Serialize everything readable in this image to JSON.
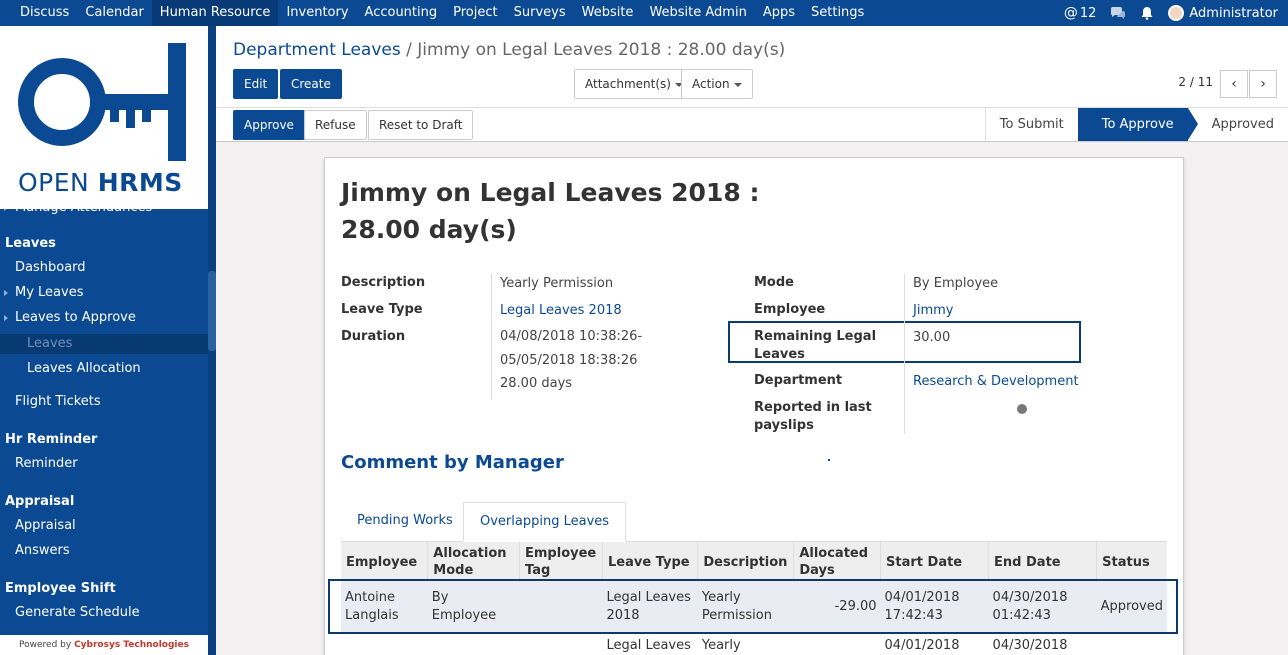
{
  "topbar": {
    "menu": [
      "Discuss",
      "Calendar",
      "Human Resource",
      "Inventory",
      "Accounting",
      "Project",
      "Surveys",
      "Website",
      "Website Admin",
      "Apps",
      "Settings"
    ],
    "active_menu": "Human Resource",
    "mentions_count": "12",
    "user": "Administrator"
  },
  "logo": {
    "word1": "OPEN ",
    "word2": "HRMS"
  },
  "sidebar": {
    "partial_item": "Manage Attendances",
    "leaves_header": "Leaves",
    "dashboard": "Dashboard",
    "my_leaves": "My Leaves",
    "leaves_to_approve": "Leaves to Approve",
    "leaves": "Leaves",
    "leaves_allocation": "Leaves Allocation",
    "flight_tickets": "Flight Tickets",
    "hr_reminder_header": "Hr Reminder",
    "reminder": "Reminder",
    "appraisal_header": "Appraisal",
    "appraisal": "Appraisal",
    "answers": "Answers",
    "employee_shift_header": "Employee Shift",
    "generate_schedule": "Generate Schedule",
    "powered_prefix": "Powered by ",
    "powered_company": "Cybrosys Technologies"
  },
  "breadcrumb": {
    "parent": "Department Leaves",
    "separator": " / ",
    "current": "Jimmy on Legal Leaves 2018 : 28.00 day(s)"
  },
  "toolbar": {
    "edit": "Edit",
    "create": "Create",
    "attachments": "Attachment(s)",
    "action": "Action",
    "pager": "2 / 11",
    "prev": "‹",
    "next": "›"
  },
  "statusbar": {
    "approve": "Approve",
    "refuse": "Refuse",
    "reset": "Reset to Draft",
    "stages": [
      "To Submit",
      "To Approve",
      "Approved"
    ],
    "current_stage": "To Approve"
  },
  "form": {
    "title_line1": "Jimmy on Legal Leaves 2018 :",
    "title_line2": "28.00 day(s)",
    "description_label": "Description",
    "description": "Yearly Permission",
    "leave_type_label": "Leave Type",
    "leave_type": "Legal Leaves 2018",
    "duration_label": "Duration",
    "duration_from": "04/08/2018 10:38:26-",
    "duration_to": "05/05/2018 18:38:26",
    "duration_days": "28.00 days",
    "mode_label": "Mode",
    "mode": "By Employee",
    "employee_label": "Employee",
    "employee": "Jimmy",
    "remaining_label_1": "Remaining Legal",
    "remaining_label_2": "Leaves",
    "remaining": "30.00",
    "department_label": "Department",
    "department": "Research & Development",
    "reported_label_1": "Reported in last",
    "reported_label_2": "payslips",
    "comment_title": "Comment by Manager"
  },
  "tabs": {
    "pending": "Pending Works",
    "overlapping": "Overlapping Leaves"
  },
  "table": {
    "headers": {
      "employee": "Employee",
      "alloc_mode_1": "Allocation",
      "alloc_mode_2": "Mode",
      "emp_tag_1": "Employee",
      "emp_tag_2": "Tag",
      "leave_type": "Leave Type",
      "description": "Description",
      "alloc_days_1": "Allocated",
      "alloc_days_2": "Days",
      "start": "Start Date",
      "end": "End Date",
      "status": "Status"
    },
    "row1": {
      "employee_1": "Antoine",
      "employee_2": "Langlais",
      "mode": "By Employee",
      "tag": "",
      "leave_type_1": "Legal Leaves",
      "leave_type_2": "2018",
      "desc_1": "Yearly",
      "desc_2": "Permission",
      "days": "-29.00",
      "start_1": "04/01/2018",
      "start_2": "17:42:43",
      "end_1": "04/30/2018",
      "end_2": "01:42:43",
      "status": "Approved"
    },
    "row2": {
      "leave_type_1": "Legal Leaves",
      "desc_1": "Yearly",
      "start_1": "04/01/2018",
      "end_1": "04/30/2018"
    }
  },
  "colors": {
    "brand": "#0b4a93",
    "highlight_border": "#0b3a6f"
  }
}
